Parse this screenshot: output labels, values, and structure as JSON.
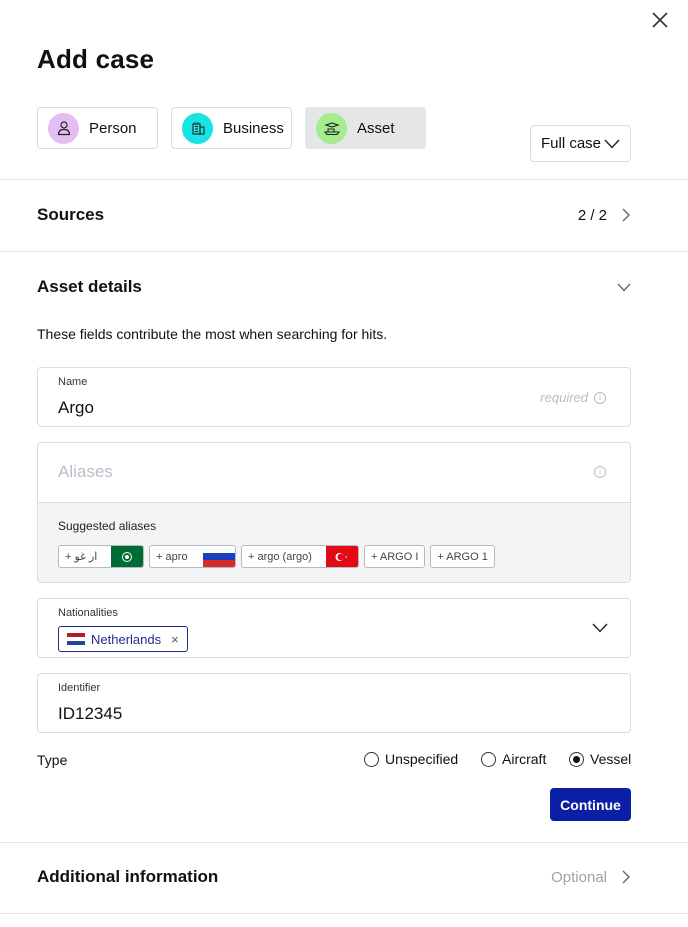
{
  "header": {
    "title": "Add case",
    "close_icon": "close-icon"
  },
  "entity_tabs": [
    {
      "label": "Person",
      "icon": "person-icon",
      "color": "#e4bdf2",
      "active": false
    },
    {
      "label": "Business",
      "icon": "building-icon",
      "color": "#19e3e3",
      "active": false
    },
    {
      "label": "Asset",
      "icon": "asset-icon",
      "color": "#a4ec8e",
      "active": true
    }
  ],
  "scope_select": {
    "value": "Full case"
  },
  "sources": {
    "title": "Sources",
    "count": "2 / 2"
  },
  "asset_details": {
    "title": "Asset details",
    "hint": "These fields contribute the most when searching for hits.",
    "name_field": {
      "label": "Name",
      "value": "Argo",
      "required_text": "required"
    },
    "aliases_field": {
      "placeholder": "Aliases"
    },
    "suggested_aliases": {
      "label": "Suggested aliases",
      "items": [
        {
          "text": "+ ار غو",
          "flag": "saudi-arabia-flag"
        },
        {
          "text": "+ арго",
          "flag": "russia-flag"
        },
        {
          "text": "+ argo (argo)",
          "flag": "turkey-flag"
        },
        {
          "text": "+ ARGO I",
          "flag": ""
        },
        {
          "text": "+ ARGO 1",
          "flag": ""
        }
      ]
    },
    "nationalities_field": {
      "label": "Nationalities",
      "selected": "Netherlands",
      "remove_icon": "×"
    },
    "identifier_field": {
      "label": "Identifier",
      "value": "ID12345"
    },
    "type": {
      "label": "Type",
      "options": [
        "Unspecified",
        "Aircraft",
        "Vessel"
      ],
      "selected": "Vessel"
    },
    "continue_label": "Continue"
  },
  "additional_information": {
    "title": "Additional information",
    "status": "Optional"
  },
  "colors": {
    "primary_button": "#0a1fa3",
    "chip_border": "#1e2d8f"
  }
}
